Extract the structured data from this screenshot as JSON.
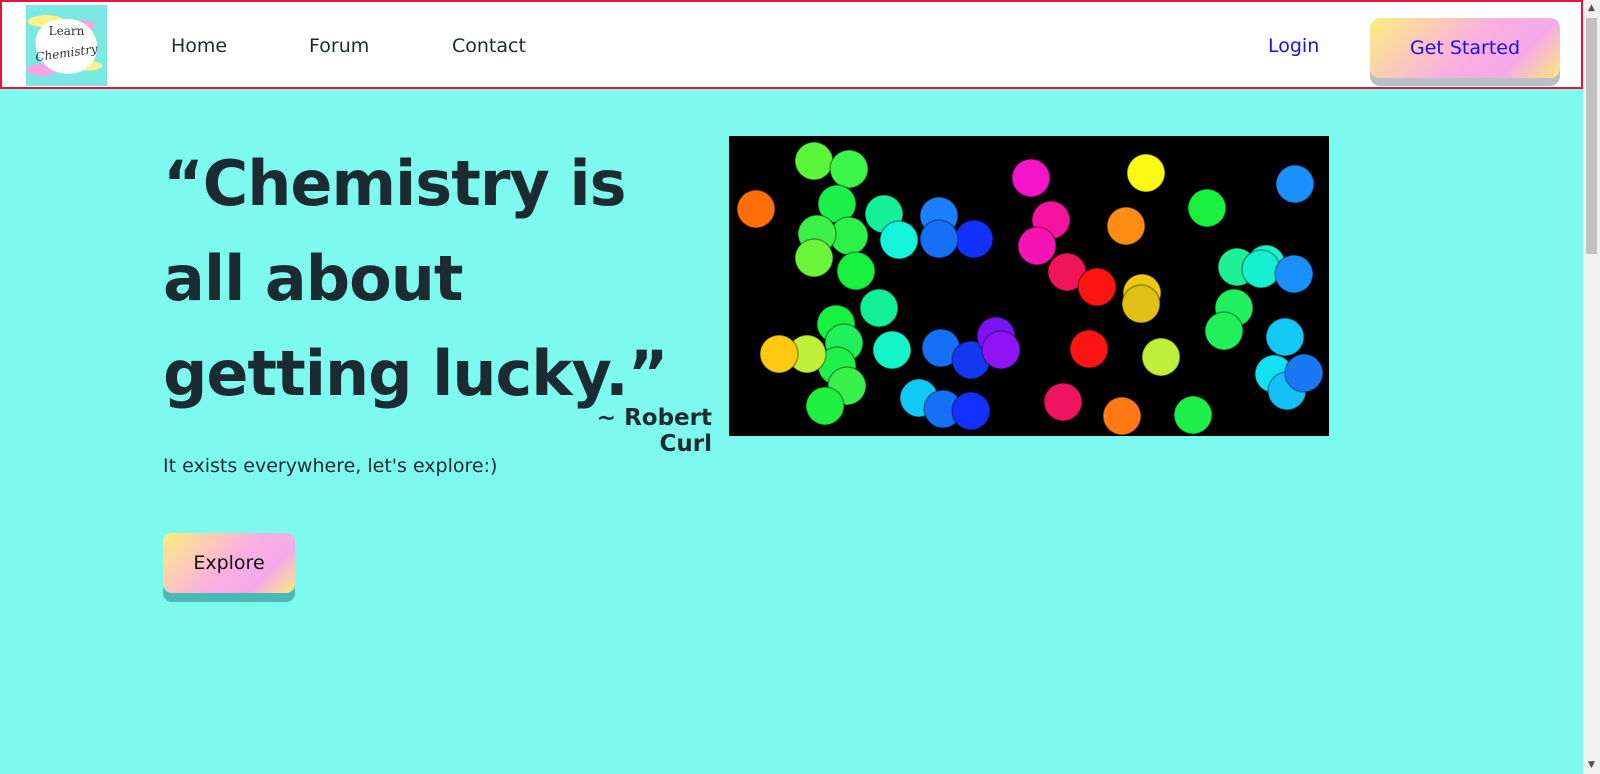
{
  "nav": {
    "logo_line1": "Learn",
    "logo_line2": "Chemistry",
    "links": [
      "Home",
      "Forum",
      "Contact"
    ],
    "login": "Login",
    "cta": "Get Started"
  },
  "hero": {
    "quote": "“Chemistry is all about getting lucky.”",
    "author": "~ Robert Curl",
    "tagline": "It exists everywhere, let's explore:)",
    "button": "Explore"
  },
  "colors": {
    "background": "#7ef9ee",
    "nav_border": "#e8123c",
    "link_blue": "#1a10e8",
    "text_dark": "#1c2b33"
  },
  "icons": {
    "scroll_up": "arrow-up-icon",
    "scroll_down": "arrow-down-icon"
  }
}
